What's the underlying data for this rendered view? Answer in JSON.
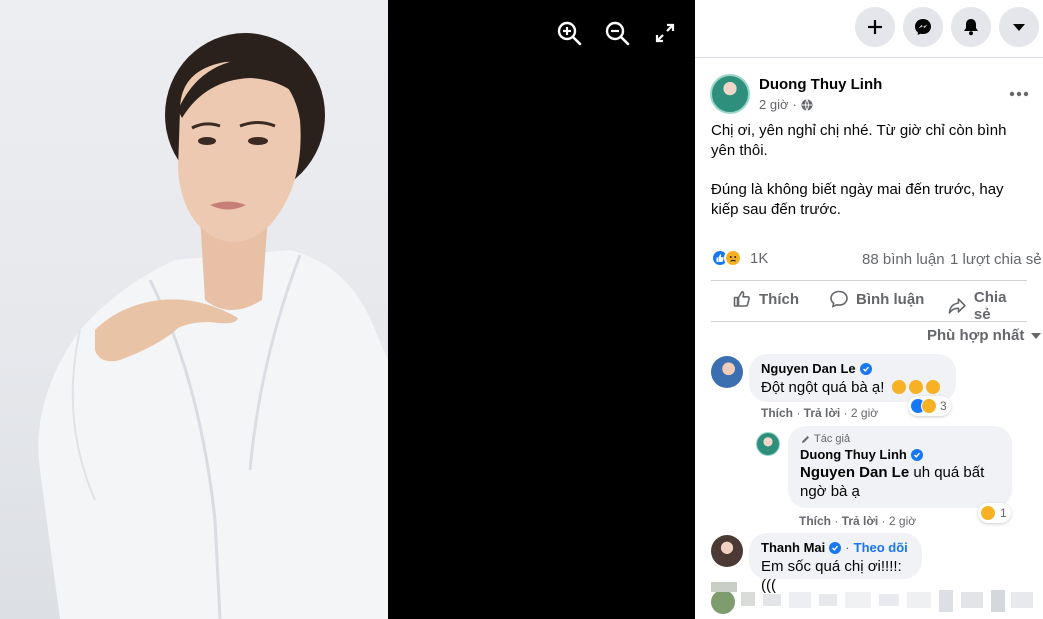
{
  "viewer": {
    "zoom_in_icon": "zoom-in-icon",
    "zoom_out_icon": "zoom-out-icon",
    "fullscreen_icon": "expand-icon"
  },
  "topbar": {
    "icons": [
      "plus-icon",
      "messenger-icon",
      "bell-icon",
      "caret-down-icon"
    ]
  },
  "post": {
    "author": "Duong Thuy Linh",
    "time": "2 giờ",
    "privacy_icon": "globe-icon",
    "text_paragraphs": [
      "Chị ơi, yên nghỉ chị nhé. Từ giờ chỉ còn bình yên thôi.",
      "Đúng là không biết ngày mai đến trước, hay kiếp sau đến trước."
    ],
    "reaction_count": "1K",
    "comments_count": "88 bình luận",
    "shares_count": "1 lượt chia sẻ",
    "actions": {
      "like": "Thích",
      "comment": "Bình luận",
      "share": "Chia sẻ"
    },
    "sort_label": "Phù hợp nhất"
  },
  "comments": [
    {
      "name": "Nguyen Dan Le",
      "text": "Đột ngột quá bà ạ!",
      "like": "Thích",
      "reply": "Trả lời",
      "time": "2 giờ",
      "reaction_count": "3"
    },
    {
      "badge": "Tác giả",
      "name": "Duong Thuy Linh",
      "mention": "Nguyen Dan Le",
      "text": " uh quá bất ngờ bà ạ",
      "like": "Thích",
      "reply": "Trả lời",
      "time": "2 giờ",
      "reaction_count": "1"
    },
    {
      "name": "Thanh Mai",
      "follow": "Theo dõi",
      "text": "Em sốc quá chị ơi!!!!:((("
    }
  ],
  "colors": {
    "brand_blue": "#1877f2",
    "secondary_text": "#65676b",
    "bubble": "#f0f2f5",
    "reaction_sad": "#f7b125"
  }
}
